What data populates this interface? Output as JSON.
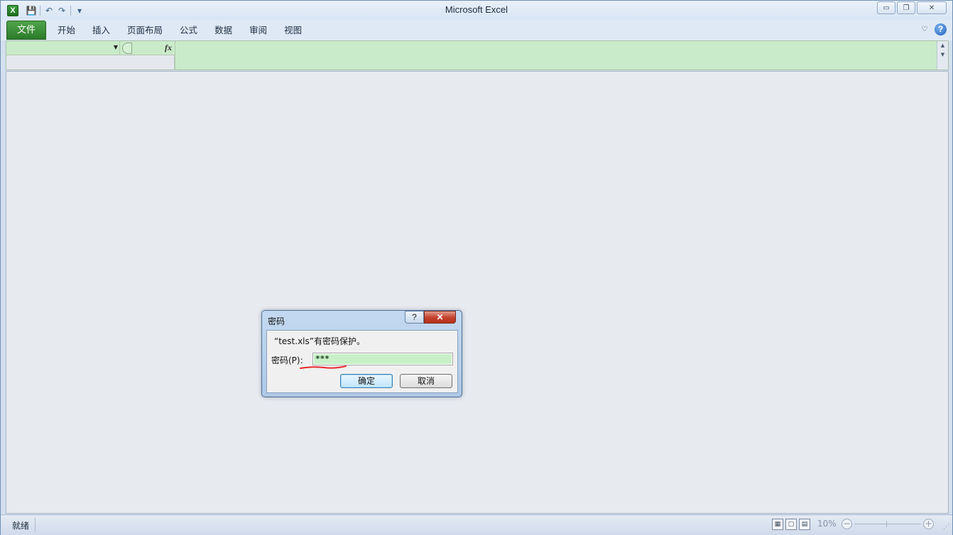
{
  "window": {
    "title": "Microsoft Excel",
    "app_icon_glyph": "X",
    "controls": {
      "minimize": "▭",
      "restore": "❐",
      "close": "✕"
    }
  },
  "quick_access": {
    "save": "💾",
    "undo": "↶",
    "redo": "↷",
    "customize": "▾"
  },
  "ribbon": {
    "file_tab": "文件",
    "tabs": [
      "开始",
      "插入",
      "页面布局",
      "公式",
      "数据",
      "审阅",
      "视图"
    ],
    "minimize_glyph": "♡",
    "help_glyph": "?"
  },
  "formula_bar": {
    "fx_label": "fx",
    "namebox_dropdown": "▼",
    "scroll_up": "▲",
    "scroll_down": "▼"
  },
  "statusbar": {
    "status": "就绪",
    "zoom_level": "10%",
    "zoom_minus": "−",
    "zoom_plus": "+",
    "resize_grip": "⋰"
  },
  "dialog": {
    "title": "密码",
    "help_glyph": "?",
    "close_glyph": "✕",
    "message": "“test.xls”有密码保护。",
    "password_label": "密码(P):",
    "password_value": "***",
    "ok_label": "确定",
    "cancel_label": "取消"
  },
  "colors": {
    "file_tab": "#2c7a2a",
    "formula_bar_highlight": "#c9ebc9",
    "annotation_underline": "#e8282a",
    "close_button": "#c2402c"
  }
}
